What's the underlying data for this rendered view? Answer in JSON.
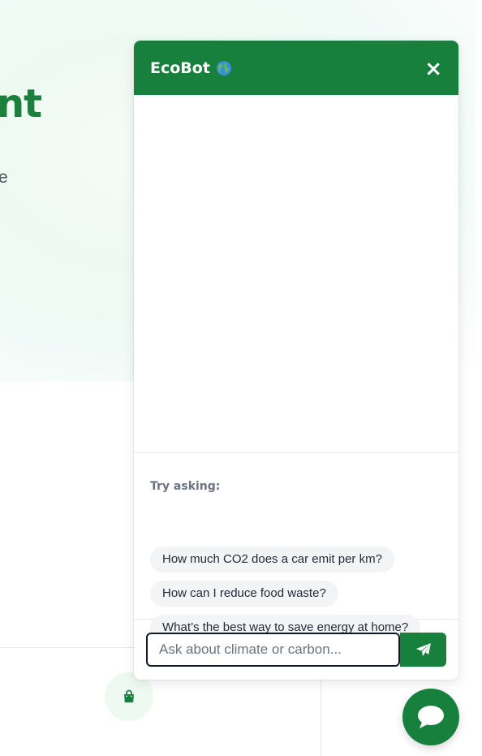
{
  "hero": {
    "title_fragment": "nt",
    "subtitle_fragment": "e"
  },
  "chat": {
    "title": "EcoBot",
    "close_label": "×",
    "try_label": "Try asking:",
    "suggestions": [
      "How much CO2 does a car emit per km?",
      "How can I reduce food waste?",
      "What’s the best way to save energy at home?"
    ],
    "input_placeholder": "Ask about climate or carbon...",
    "input_value": ""
  },
  "icons": {
    "globe": "globe-icon",
    "close": "close-icon",
    "send": "paper-plane-icon",
    "bag": "shopping-bag-icon",
    "chat": "chat-bubble-icon"
  },
  "colors": {
    "brand_green": "#17803d",
    "hero_green": "#1b7f3e",
    "chip_bg": "#f3f4f6",
    "muted_text": "#6b7280",
    "light_green_bg": "#eefaf1"
  }
}
